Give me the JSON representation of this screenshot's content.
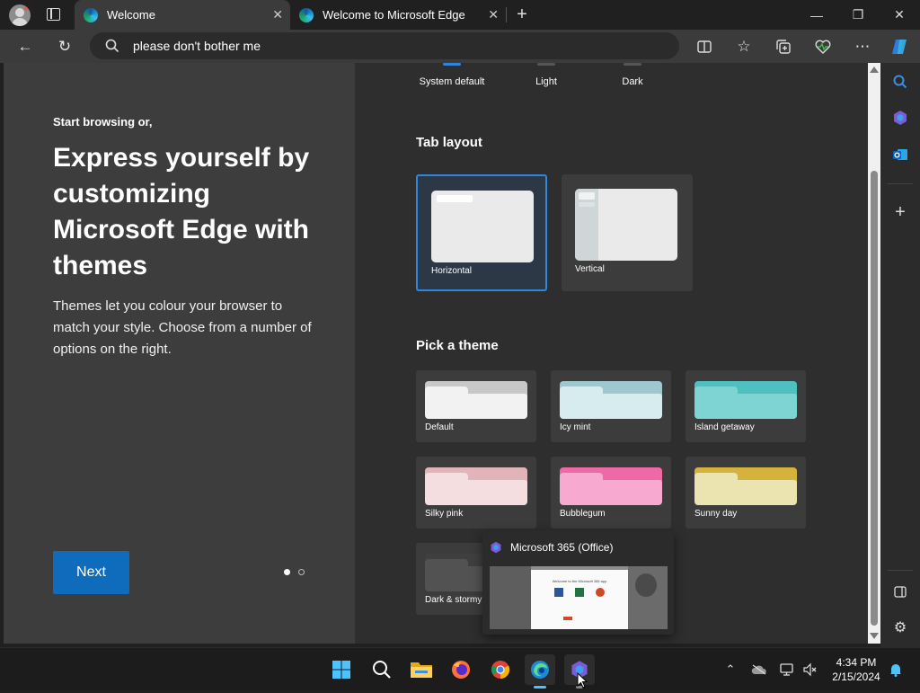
{
  "tabs": [
    {
      "title": "Welcome",
      "active": true
    },
    {
      "title": "Welcome to Microsoft Edge",
      "active": false
    }
  ],
  "window_controls": {
    "minimize": "—",
    "restore": "❐",
    "close": "✕"
  },
  "address_bar": {
    "text": "please don't bother me",
    "icon": "search-icon"
  },
  "toolbar_icons": [
    "split-screen-icon",
    "favorites-icon",
    "collections-icon",
    "browser-essentials-icon",
    "more-icon",
    "copilot-icon"
  ],
  "left_pane": {
    "intro": "Start browsing or,",
    "headline": "Express yourself by customizing Microsoft Edge with themes",
    "description": "Themes let you colour your browser to match your style. Choose from a number of options on the right.",
    "next_label": "Next",
    "pagination": {
      "total": 2,
      "current": 1
    }
  },
  "appearance": {
    "options": [
      "System default",
      "Light",
      "Dark"
    ],
    "selected": "System default"
  },
  "tab_layout": {
    "title": "Tab layout",
    "options": [
      "Horizontal",
      "Vertical"
    ],
    "selected": "Horizontal"
  },
  "themes": {
    "title": "Pick a theme",
    "items": [
      {
        "name": "Default",
        "color": "#c8c8c8",
        "front": "#f2f2f2"
      },
      {
        "name": "Icy mint",
        "color": "#9fc7cf",
        "front": "#d6ecef"
      },
      {
        "name": "Island getaway",
        "color": "#4fc0c0",
        "front": "#7dd4d2"
      },
      {
        "name": "Silky pink",
        "color": "#e0b4b8",
        "front": "#f5dedf"
      },
      {
        "name": "Bubblegum",
        "color": "#ee6aa7",
        "front": "#f7a9cf"
      },
      {
        "name": "Sunny day",
        "color": "#d4b23c",
        "front": "#ece4b0"
      },
      {
        "name": "Dark & stormy",
        "color": "#3f3f3f",
        "front": "#525252"
      }
    ]
  },
  "popup": {
    "title": "Microsoft 365 (Office)",
    "preview_text": "Welcome to the Microsoft 365 app"
  },
  "sidebar_icons": [
    "search-icon",
    "copilot-icon",
    "outlook-icon",
    "add-icon",
    "sidebar-toggle-icon",
    "settings-icon"
  ],
  "taskbar": {
    "apps": [
      "start-icon",
      "search-icon",
      "file-explorer-icon",
      "firefox-icon",
      "chrome-icon",
      "edge-icon",
      "microsoft-365-icon"
    ],
    "time": "4:34 PM",
    "date": "2/15/2024"
  }
}
